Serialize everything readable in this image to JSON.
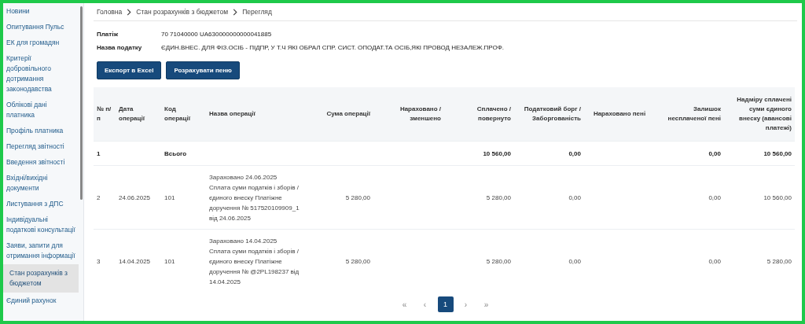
{
  "sidebar": {
    "items": [
      {
        "label": "Новини",
        "selected": false
      },
      {
        "label": "Опитування Пульс",
        "selected": false
      },
      {
        "label": "ЕК для громадян",
        "selected": false
      },
      {
        "label": "Критерії добровільного дотримання законодавства",
        "selected": false
      },
      {
        "label": "Облікові дані платника",
        "selected": false
      },
      {
        "label": "Профіль платника",
        "selected": false
      },
      {
        "label": "Перегляд звітності",
        "selected": false
      },
      {
        "label": "Введення звітності",
        "selected": false
      },
      {
        "label": "Вхідні/вихідні документи",
        "selected": false
      },
      {
        "label": "Листування з ДПС",
        "selected": false
      },
      {
        "label": "Індивідуальні податкові консультації",
        "selected": false
      },
      {
        "label": "Заяви, запити для отримання інформації",
        "selected": false
      },
      {
        "label": "Стан розрахунків з бюджетом",
        "selected": true
      },
      {
        "label": "Єдиний рахунок",
        "selected": false
      }
    ]
  },
  "breadcrumb": [
    "Головна",
    "Стан розрахунків з бюджетом",
    "Перегляд"
  ],
  "info": [
    {
      "label": "Платіж",
      "value": "70 71040000 UA630000000000041885"
    },
    {
      "label": "Назва податку",
      "value": "ЄДИН.ВНЕС. ДЛЯ ФІЗ.ОСІБ - ПІДПР, У Т.Ч ЯКІ ОБРАЛ СПР. СИСТ. ОПОДАТ.ТА ОСІБ,ЯКІ ПРОВОД НЕЗАЛЕЖ.ПРОФ."
    }
  ],
  "buttons": [
    "Експорт в Excel",
    "Розрахувати пеню"
  ],
  "table": {
    "columns": [
      "№ п/п",
      "Дата операції",
      "Код операції",
      "Назва операції",
      "Сума операції",
      "Нараховано / зменшено",
      "Сплачено / повернуто",
      "Податковий борг / Заборгованість",
      "Нараховано пені",
      "Залишок несплаченої пені",
      "Надміру сплачені суми єдиного внеску (авансові платежі)"
    ],
    "rows": [
      {
        "kind": "total",
        "cells": [
          "1",
          "",
          "Всього",
          "",
          "",
          "",
          "10 560,00",
          "0,00",
          "",
          "0,00",
          "10 560,00"
        ]
      },
      {
        "kind": "entry",
        "cells": [
          "2",
          "24.06.2025",
          "101",
          "Зараховано 24.06.2025 Сплата суми податків і зборів / єдиного внеску Платіжне доручення № 517520109909_1 від 24.06.2025",
          "5 280,00",
          "",
          "5 280,00",
          "0,00",
          "",
          "0,00",
          "10 560,00"
        ]
      },
      {
        "kind": "entry",
        "cells": [
          "3",
          "14.04.2025",
          "101",
          "Зараховано 14.04.2025 Сплата суми податків і зборів / єдиного внеску Платіжне доручення № @2PL198237 від 14.04.2025",
          "5 280,00",
          "",
          "5 280,00",
          "0,00",
          "",
          "0,00",
          "5 280,00"
        ]
      }
    ]
  },
  "pagination": [
    {
      "label": "«",
      "selected": false
    },
    {
      "label": "‹",
      "selected": false
    },
    {
      "label": "1",
      "selected": true
    },
    {
      "label": "›",
      "selected": false
    },
    {
      "label": "»",
      "selected": false
    }
  ]
}
